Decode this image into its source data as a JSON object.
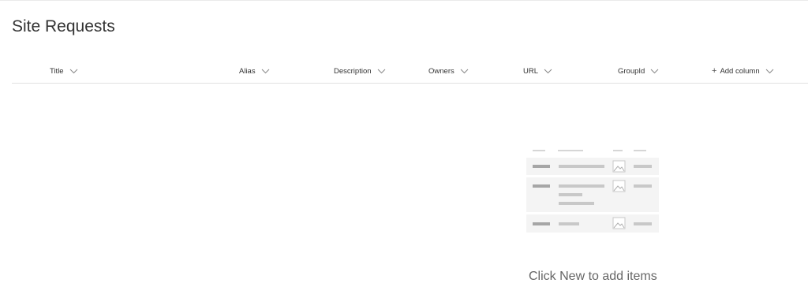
{
  "page": {
    "title": "Site Requests"
  },
  "columns": [
    {
      "label": "Title"
    },
    {
      "label": "Alias"
    },
    {
      "label": "Description"
    },
    {
      "label": "Owners"
    },
    {
      "label": "URL"
    },
    {
      "label": "GroupId"
    },
    {
      "label": "Add column",
      "icon": "plus-icon"
    }
  ],
  "empty_state": {
    "message": "Click New to add items"
  },
  "colors": {
    "text": "#333333",
    "muted_text": "#666666",
    "divider": "#e1e1e1",
    "illustration_bg": "#f4f4f4",
    "illustration_bar": "#c8c8c8"
  }
}
